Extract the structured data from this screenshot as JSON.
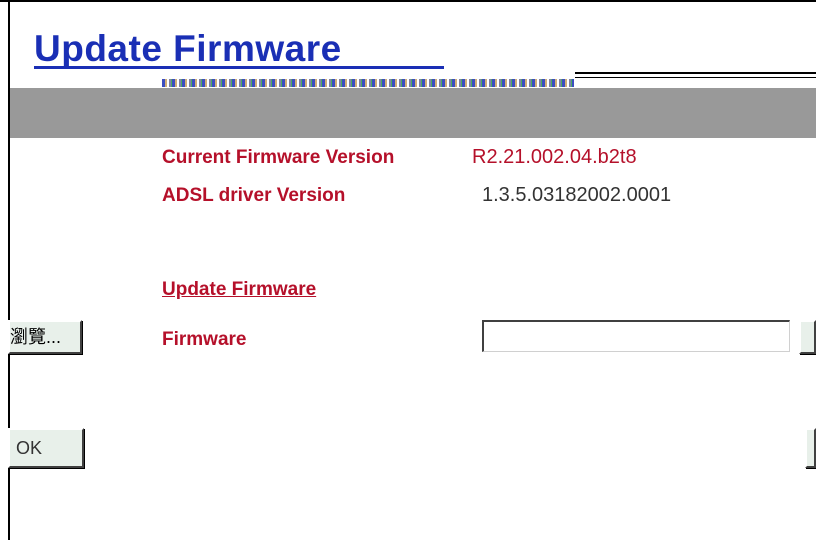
{
  "page": {
    "title": "Update Firmware"
  },
  "info": {
    "current_firmware_label": "Current Firmware Version",
    "current_firmware_value": "R2.21.002.04.b2t8",
    "adsl_driver_label": "ADSL driver Version",
    "adsl_driver_value": "1.3.5.03182002.0001"
  },
  "update_section": {
    "heading": "Update Firmware",
    "firmware_label": "Firmware",
    "firmware_value": "",
    "browse_label": "瀏覽..."
  },
  "actions": {
    "ok_label": "OK"
  },
  "colors": {
    "title": "#1a2fb5",
    "label": "#b5102a",
    "band": "#999999"
  }
}
